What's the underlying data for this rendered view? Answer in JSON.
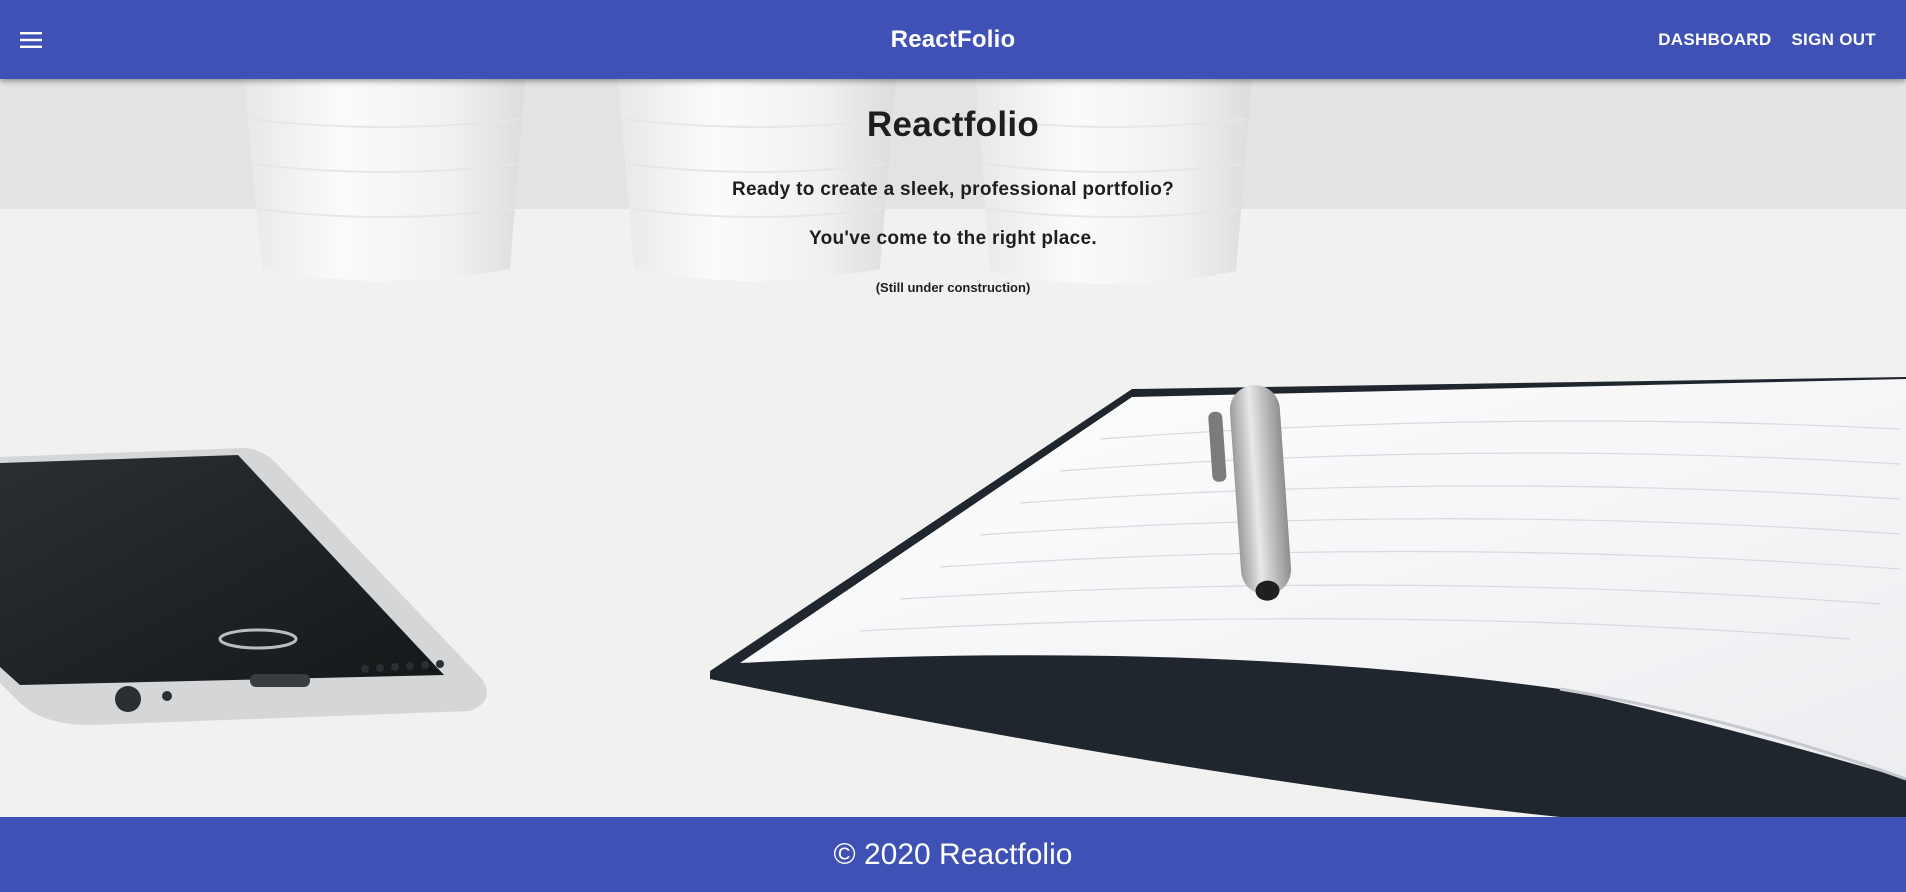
{
  "appbar": {
    "menu_icon": "hamburger-menu-icon",
    "title": "ReactFolio",
    "nav": {
      "dashboard": "DASHBOARD",
      "sign_out": "SIGN OUT"
    }
  },
  "hero": {
    "heading": "Reactfolio",
    "line1": "Ready to create a sleek, professional portfolio?",
    "line2": "You've come to the right place.",
    "note": "(Still under construction)"
  },
  "footer": {
    "text": "© 2020 Reactfolio"
  },
  "colors": {
    "primary": "#3f51b5",
    "on_primary": "#ffffff",
    "text_dark": "#1e1e1e"
  }
}
